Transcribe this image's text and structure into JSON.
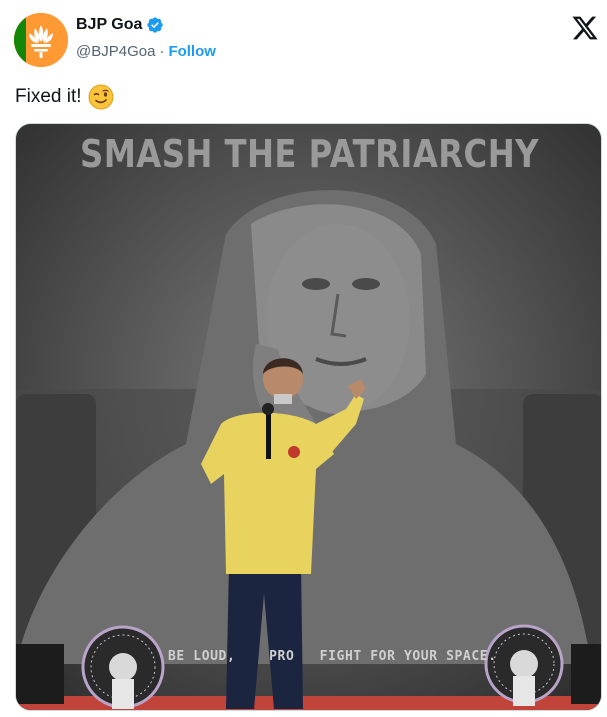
{
  "author": {
    "display_name": "BJP Goa",
    "handle": "@BJP4Goa",
    "separator": "·",
    "follow_label": "Follow"
  },
  "tweet": {
    "text": "Fixed it!",
    "emoji": "winking-face"
  },
  "media": {
    "banner_title": "SMASH THE PATRIARCHY",
    "banner_subtitle": "BE LOUD,    PRO   FIGHT FOR YOUR SPACE."
  },
  "colors": {
    "brand_orange": "#ff9933",
    "link_blue": "#1d9bf0",
    "verified_blue": "#1d9bf0",
    "shirt_yellow": "#e8d35e"
  },
  "icons": [
    "bjp-lotus-logo",
    "verified-badge-icon",
    "x-logo-icon",
    "winking-face-emoji"
  ]
}
